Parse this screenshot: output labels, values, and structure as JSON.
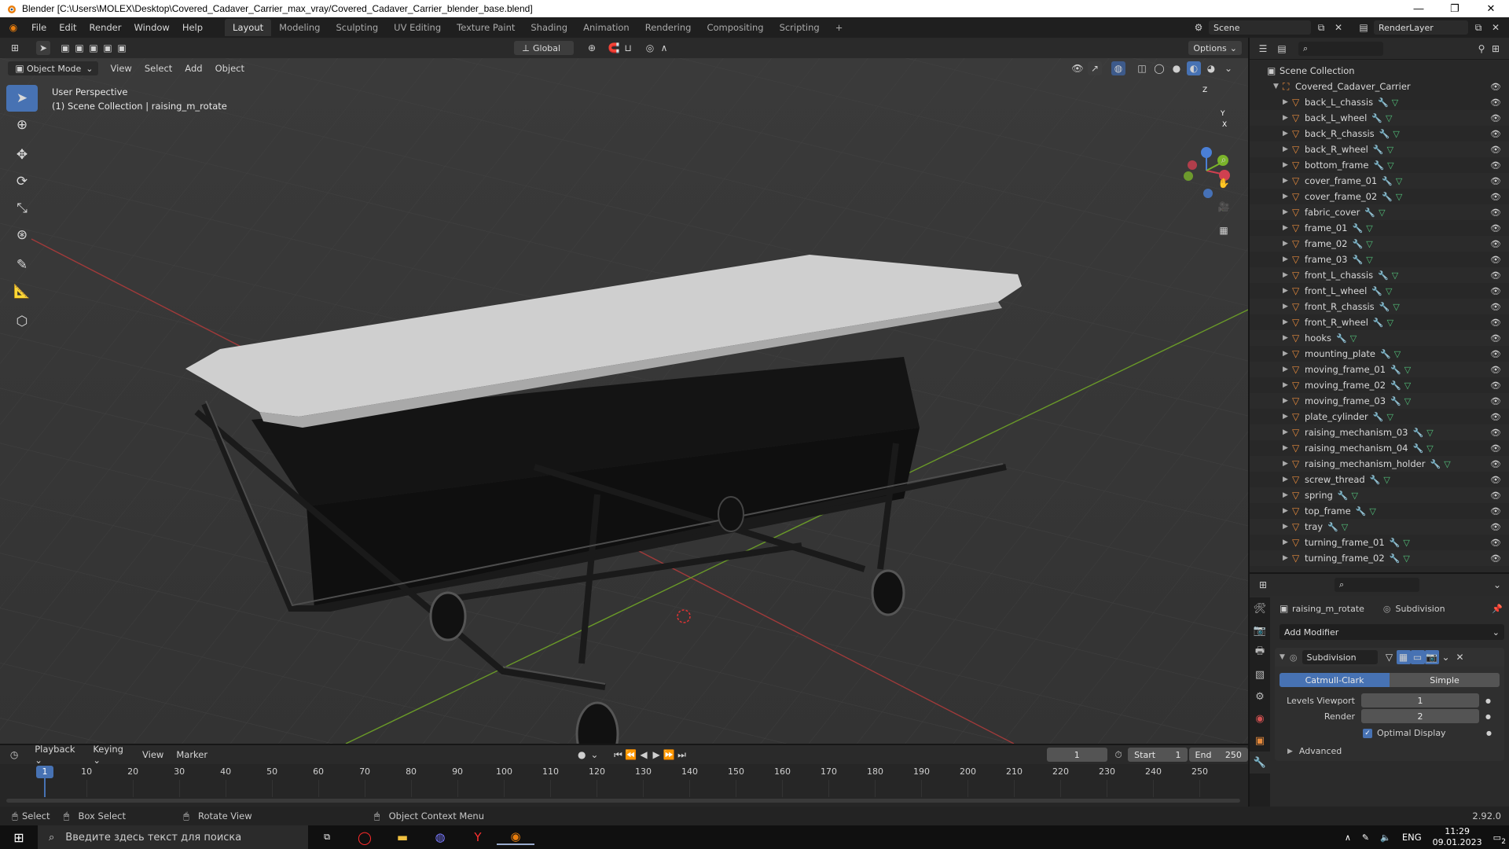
{
  "window": {
    "title": "Blender [C:\\Users\\MOLEX\\Desktop\\Covered_Cadaver_Carrier_max_vray/Covered_Cadaver_Carrier_blender_base.blend]",
    "controls": [
      "—",
      "❐",
      "✕"
    ]
  },
  "menubar": {
    "menus": [
      "File",
      "Edit",
      "Render",
      "Window",
      "Help"
    ],
    "workspaces": [
      "Layout",
      "Modeling",
      "Sculpting",
      "UV Editing",
      "Texture Paint",
      "Shading",
      "Animation",
      "Rendering",
      "Compositing",
      "Scripting"
    ],
    "active_workspace": "Layout",
    "add_tab": "+",
    "scene": "Scene",
    "render_layer": "RenderLayer"
  },
  "viewport_header": {
    "transform_orientation": "Global",
    "options_label": "Options",
    "mode": "Object Mode",
    "menus": [
      "View",
      "Select",
      "Add",
      "Object"
    ]
  },
  "viewport": {
    "perspective": "User Perspective",
    "collection_info": "(1) Scene Collection | raising_m_rotate",
    "gizmo": {
      "z": "Z",
      "y": "Y",
      "x": "X"
    }
  },
  "outliner": {
    "search_placeholder": "",
    "root": "Scene Collection",
    "collection": "Covered_Cadaver_Carrier",
    "items": [
      "back_L_chassis",
      "back_L_wheel",
      "back_R_chassis",
      "back_R_wheel",
      "bottom_frame",
      "cover_frame_01",
      "cover_frame_02",
      "fabric_cover",
      "frame_01",
      "frame_02",
      "frame_03",
      "front_L_chassis",
      "front_L_wheel",
      "front_R_chassis",
      "front_R_wheel",
      "hooks",
      "mounting_plate",
      "moving_frame_01",
      "moving_frame_02",
      "moving_frame_03",
      "plate_cylinder",
      "raising_mechanism_03",
      "raising_mechanism_04",
      "raising_mechanism_holder",
      "screw_thread",
      "spring",
      "top_frame",
      "tray",
      "turning_frame_01",
      "turning_frame_02"
    ]
  },
  "properties": {
    "object_name": "raising_m_rotate",
    "modifier_context": "Subdivision",
    "add_modifier": "Add Modifier",
    "modifier": {
      "name": "Subdivision",
      "type_options": [
        "Catmull-Clark",
        "Simple"
      ],
      "selected_type": "Catmull-Clark",
      "levels_viewport_label": "Levels Viewport",
      "levels_viewport": "1",
      "render_label": "Render",
      "render": "2",
      "optimal_display_label": "Optimal Display",
      "optimal_display": true,
      "advanced_label": "Advanced"
    }
  },
  "timeline": {
    "menus": [
      "Playback",
      "Keying",
      "View",
      "Marker"
    ],
    "current_frame": "1",
    "start_label": "Start",
    "start": "1",
    "end_label": "End",
    "end": "250",
    "ticks": [
      "1",
      "10",
      "20",
      "30",
      "40",
      "50",
      "60",
      "70",
      "80",
      "90",
      "100",
      "110",
      "120",
      "130",
      "140",
      "150",
      "160",
      "170",
      "180",
      "190",
      "200",
      "210",
      "220",
      "230",
      "240",
      "250"
    ]
  },
  "statusbar": {
    "select": "Select",
    "box_select": "Box Select",
    "rotate_view": "Rotate View",
    "context_menu": "Object Context Menu",
    "version": "2.92.0"
  },
  "taskbar": {
    "search_placeholder": "Введите здесь текст для поиска",
    "lang": "ENG",
    "time": "11:29",
    "date": "09.01.2023",
    "notifications": "2"
  }
}
